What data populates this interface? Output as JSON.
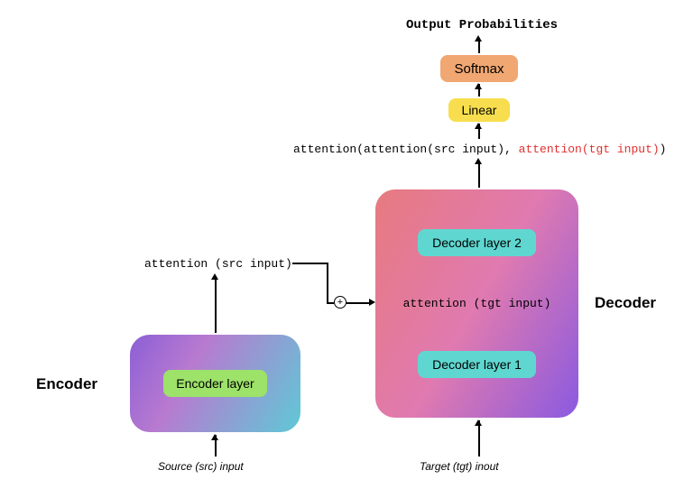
{
  "title": "Output Probabilities",
  "boxes": {
    "softmax": "Softmax",
    "linear": "Linear",
    "encoder_layer": "Encoder layer",
    "decoder_layer_2": "Decoder layer 2",
    "decoder_layer_1": "Decoder layer 1"
  },
  "labels": {
    "encoder": "Encoder",
    "decoder": "Decoder",
    "src_input": "Source (src) input",
    "tgt_input": "Target (tgt) inout",
    "encoder_attn": "attention (src input)",
    "decoder_mid": "attention (tgt input)"
  },
  "formula": {
    "p1": "attention(attention(src input), ",
    "p2": "attention(tgt input)",
    "p3": ")"
  },
  "symbols": {
    "plus": "+"
  }
}
